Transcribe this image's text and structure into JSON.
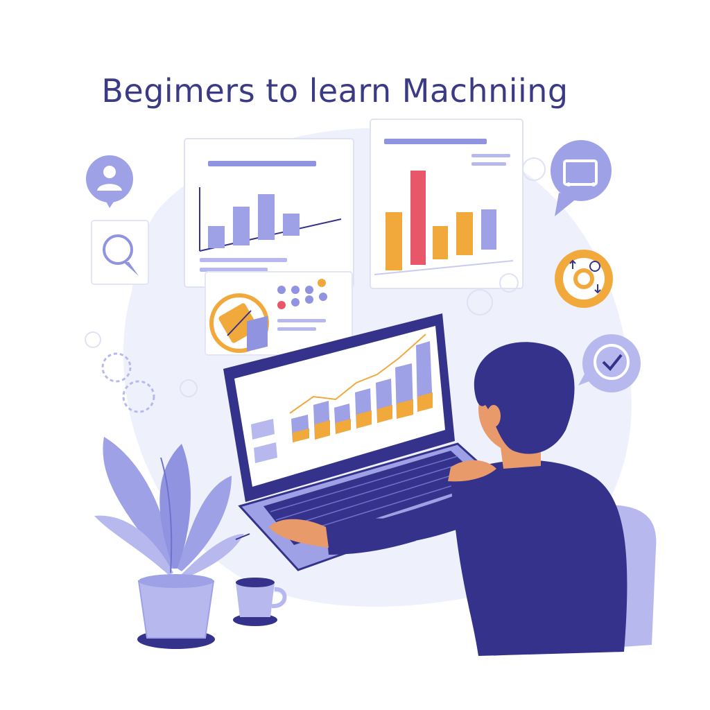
{
  "title": "Begimers to learn Machniing",
  "palette": {
    "navy": "#34328a",
    "lavender": "#8f93e0",
    "light_lavender": "#b7b9ee",
    "backdrop": "#eef0fb",
    "orange": "#f2a93b",
    "red": "#e8566a",
    "skin": "#e99a6a"
  },
  "icons": [
    "user-bubble-icon",
    "search-bubble-icon",
    "screen-bubble-icon",
    "refresh-circle-icon",
    "check-bubble-icon",
    "resize-circle-icon",
    "gear-icon"
  ]
}
